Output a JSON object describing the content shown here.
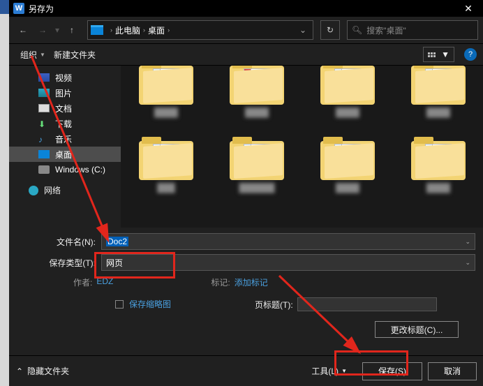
{
  "title": "另存为",
  "nav": {
    "seg1": "此电脑",
    "seg2": "桌面"
  },
  "search": {
    "placeholder": "搜索\"桌面\""
  },
  "toolbar": {
    "organize": "组织",
    "new_folder": "新建文件夹"
  },
  "sidebar": {
    "items": [
      {
        "label": "视频"
      },
      {
        "label": "图片"
      },
      {
        "label": "文档"
      },
      {
        "label": "下载"
      },
      {
        "label": "音乐"
      },
      {
        "label": "桌面"
      },
      {
        "label": "Windows (C:)"
      }
    ],
    "network": "网络"
  },
  "form": {
    "filename_label": "文件名(N):",
    "filename_value": "Doc2",
    "type_label": "保存类型(T):",
    "type_value": "网页",
    "author_label": "作者:",
    "author_value": "EDZ",
    "tags_label": "标记:",
    "tags_value": "添加标记",
    "save_thumb": "保存缩略图",
    "page_title_label": "页标题(T):",
    "change_title": "更改标题(C)..."
  },
  "footer": {
    "hide_folders": "隐藏文件夹",
    "tools": "工具(L)",
    "save": "保存(S)",
    "cancel": "取消"
  }
}
